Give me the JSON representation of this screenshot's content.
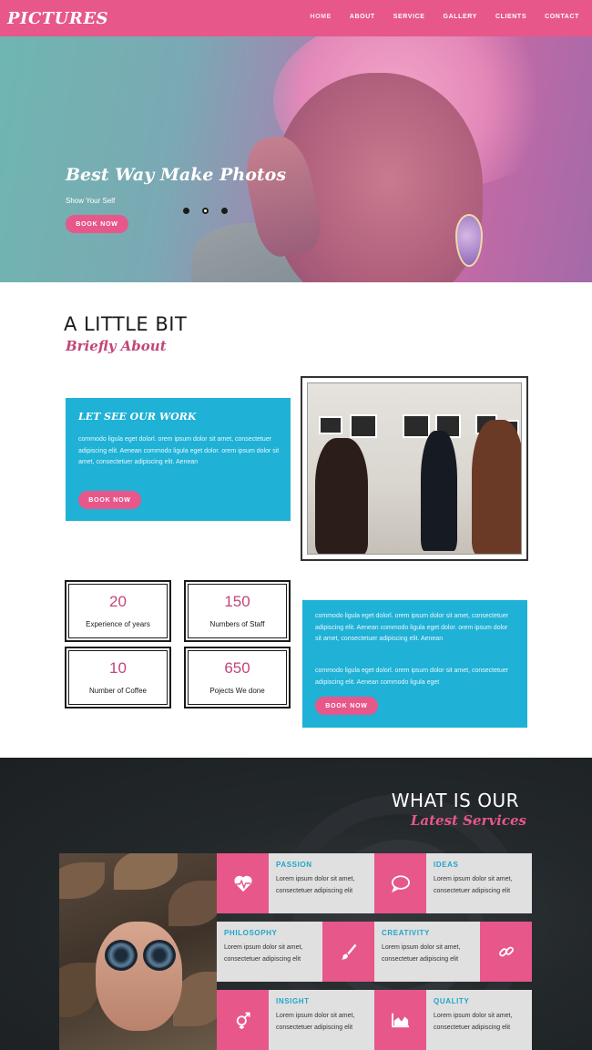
{
  "brand": {
    "logo": "PICTURES",
    "accent": "#e7578a",
    "secondary": "#1fb1d6"
  },
  "nav": {
    "items": [
      "HOME",
      "ABOUT",
      "SERVICE",
      "GALLERY",
      "CLIENTS",
      "CONTACT"
    ]
  },
  "hero": {
    "title": "Best Way Make Photos",
    "subtitle": "Show Your Self",
    "button": "BOOK NOW",
    "slides": 3,
    "active_slide": 2
  },
  "about": {
    "title": "A LITTLE BIT",
    "script": "Briefly About",
    "card": {
      "title": "LET SEE OUR WORK",
      "text": "commodo ligula eget dolorl. orem ipsum dolor sit amet, consectetuer adipiscing elit. Aenean commodo ligula eget dolor. orem ipsum dolor sit amet, consectetuer adipiscing elit. Aenean",
      "button": "BOOK NOW"
    },
    "stats": [
      {
        "value": "20",
        "label": "Experience of years"
      },
      {
        "value": "150",
        "label": "Numbers of Staff"
      },
      {
        "value": "10",
        "label": "Number of Coffee"
      },
      {
        "value": "650",
        "label": "Pojects We done"
      }
    ],
    "card2": {
      "para1": "commodo ligula eget dolorl. orem ipsum dolor sit amet, consectetuer adipiscing elit. Aenean commodo ligula eget dolor. orem ipsum dolor sit amet, consectetuer adipiscing elit. Aenean",
      "para2": "commodo ligula eget dolorl. orem ipsum dolor sit amet, consectetuer adipiscing elit. Aenean commodo ligula eget",
      "button": "BOOK NOW"
    }
  },
  "services": {
    "title": "WHAT IS OUR",
    "script": "Latest Services",
    "tiles": [
      {
        "name": "PASSION",
        "icon": "heartbeat-icon",
        "text": "Lorem ipsum dolor sit amet, consectetuer adipiscing elit"
      },
      {
        "name": "IDEAS",
        "icon": "chat-bubble-icon",
        "text": "Lorem ipsum dolor sit amet, consectetuer adipiscing elit"
      },
      {
        "name": "PHILOSOPHY",
        "icon": "brush-icon",
        "text": "Lorem ipsum dolor sit amet, consectetuer adipiscing elit"
      },
      {
        "name": "CREATIVITY",
        "icon": "link-icon",
        "text": "Lorem ipsum dolor sit amet, consectetuer adipiscing elit"
      },
      {
        "name": "INSIGHT",
        "icon": "gender-icon",
        "text": "Lorem ipsum dolor sit amet, consectetuer adipiscing elit"
      },
      {
        "name": "QUALITY",
        "icon": "area-chart-icon",
        "text": "Lorem ipsum dolor sit amet, consectetuer adipiscing elit"
      }
    ]
  }
}
